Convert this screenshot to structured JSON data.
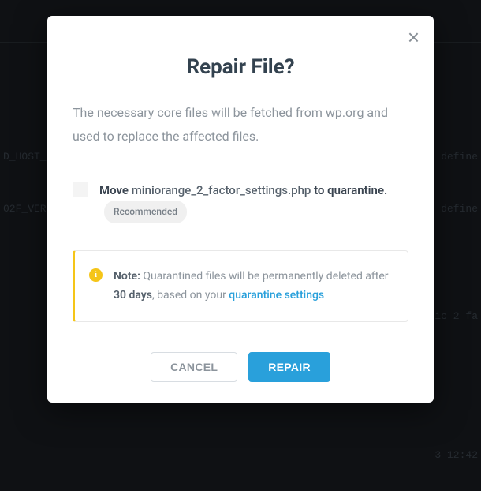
{
  "background": {
    "line1_left": "                                  ",
    "line2_left": "D_HOST_",
    "line2_right": "define",
    "line3_left": "02F_VER",
    "line3_right": "define",
    "path_hint": "/public_2_fa",
    "time_hint": "3 12:42"
  },
  "modal": {
    "title": "Repair File?",
    "description": "The necessary core files will be fetched from wp.org and used to replace the affected files.",
    "checkbox": {
      "prefix": "Move ",
      "filename": "miniorange_2_factor_settings.php",
      "suffix": " to quarantine.",
      "badge": "Recommended"
    },
    "info": {
      "note_label": "Note:",
      "text_before": " Quarantined files will be permanently deleted after ",
      "days": "30 days",
      "text_after": ", based on your ",
      "link": "quarantine settings"
    },
    "actions": {
      "cancel": "CANCEL",
      "repair": "REPAIR"
    }
  }
}
